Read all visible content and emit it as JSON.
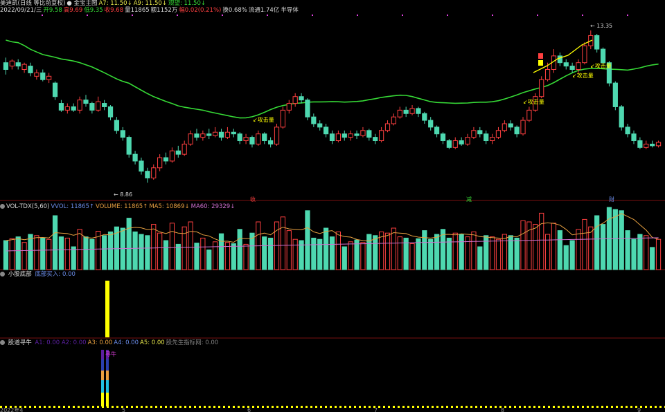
{
  "header": {
    "line1": [
      {
        "text": "美迪凯(日线 等比前复权)",
        "color": "#d8d8d8"
      },
      {
        "text": "● 金宝主图",
        "color": "#d8d8d8"
      },
      {
        "text": "A7: 11.50↓",
        "color": "#e8e84c"
      },
      {
        "text": "A9: 11.50↓",
        "color": "#e8e84c"
      },
      {
        "text": "观望: 11.50↓",
        "color": "#36d936"
      }
    ],
    "line2": [
      {
        "text": "2022/09/21/三",
        "color": "#d8d8d8"
      },
      {
        "text": "开9.58",
        "color": "#36d936"
      },
      {
        "text": "高9.69",
        "color": "#ff4040"
      },
      {
        "text": "低9.35",
        "color": "#36d936"
      },
      {
        "text": "收9.68",
        "color": "#ff4040"
      },
      {
        "text": "量11865",
        "color": "#d8d8d8"
      },
      {
        "text": "额1152万",
        "color": "#d8d8d8"
      },
      {
        "text": "幅0.02(0.21%)",
        "color": "#ff4040"
      },
      {
        "text": "换0.68%",
        "color": "#d8d8d8"
      },
      {
        "text": "流通1.74亿",
        "color": "#d8d8d8"
      },
      {
        "text": "半导体",
        "color": "#d8d8d8"
      }
    ]
  },
  "annotations": {
    "high_price": "13.35",
    "low_price": "8.86",
    "attack_volume_label": "攻击量",
    "marker_shou": "收",
    "marker_jian": "减",
    "marker_cai": "财"
  },
  "volume_panel": {
    "items": [
      {
        "text": "VOL-TDX(5,60)",
        "color": "#d8d8d8"
      },
      {
        "text": "VVOL: 11865↑",
        "color": "#6a8ce8"
      },
      {
        "text": "VOLUME: 11865↑",
        "color": "#e8a040"
      },
      {
        "text": "MA5: 10869↓",
        "color": "#e8a040"
      },
      {
        "text": "MA60: 29329↓",
        "color": "#d070d0"
      }
    ]
  },
  "bottom_panel": {
    "title": "小股底部",
    "buy_label": "底部买入: 0.00"
  },
  "finder_panel": {
    "title": "股道寻牛",
    "items": [
      {
        "text": "A1: 0.00  A2: 0.00",
        "color": "#5a20a0"
      },
      {
        "text": "A3: 0.00",
        "color": "#e8a040"
      },
      {
        "text": "A4: 0.00",
        "color": "#6a8ce8"
      },
      {
        "text": "A5: 0.00",
        "color": "#e8e84c"
      },
      {
        "text": "股先生指标网: 0.00",
        "color": "#808080"
      }
    ],
    "signal_label": "寻牛"
  },
  "x_axis": {
    "labels": [
      "2022年4",
      "5",
      "6",
      "7",
      "8",
      "9"
    ]
  },
  "colors": {
    "up": "#ff4040",
    "down": "#4ed8b0",
    "ma_line": "#36d936",
    "vol_ma5": "#e8a040",
    "vol_ma60": "#d070d0",
    "yellow": "#ffff00",
    "magenta": "#e040e0"
  },
  "chart_data": {
    "type": "candlestick",
    "dates_note": "daily bars, April–September 2022",
    "price_range": [
      8.5,
      13.8
    ],
    "high_marker": 13.35,
    "low_marker": 8.86,
    "candles": [
      [
        12.4,
        12.2,
        12.55,
        12.05
      ],
      [
        12.3,
        12.45,
        12.5,
        12.2
      ],
      [
        12.4,
        12.3,
        12.5,
        12.2
      ],
      [
        12.2,
        12.35,
        12.4,
        12.1
      ],
      [
        12.3,
        12.1,
        12.4,
        12.0
      ],
      [
        12.0,
        12.1,
        12.2,
        11.9
      ],
      [
        12.1,
        11.9,
        12.2,
        11.85
      ],
      [
        11.9,
        12.0,
        12.1,
        11.8
      ],
      [
        11.8,
        11.4,
        11.85,
        11.3
      ],
      [
        11.2,
        11.0,
        11.3,
        10.95
      ],
      [
        11.0,
        11.1,
        11.2,
        10.9
      ],
      [
        11.1,
        11.0,
        11.2,
        10.95
      ],
      [
        11.0,
        11.3,
        11.4,
        10.9
      ],
      [
        11.3,
        11.2,
        11.45,
        11.1
      ],
      [
        11.2,
        11.0,
        11.25,
        10.9
      ],
      [
        11.0,
        11.25,
        11.4,
        10.95
      ],
      [
        11.2,
        11.1,
        11.3,
        11.0
      ],
      [
        11.1,
        10.8,
        11.15,
        10.7
      ],
      [
        10.7,
        10.4,
        10.8,
        10.3
      ],
      [
        10.4,
        10.2,
        10.5,
        10.1
      ],
      [
        10.2,
        9.7,
        10.25,
        9.6
      ],
      [
        9.7,
        9.5,
        9.8,
        9.4
      ],
      [
        9.5,
        9.2,
        9.6,
        9.1
      ],
      [
        9.2,
        9.0,
        9.3,
        8.86
      ],
      [
        9.0,
        9.3,
        9.4,
        8.95
      ],
      [
        9.3,
        9.6,
        9.7,
        9.2
      ],
      [
        9.6,
        9.5,
        9.75,
        9.4
      ],
      [
        9.5,
        9.8,
        9.9,
        9.45
      ],
      [
        9.8,
        9.7,
        9.95,
        9.6
      ],
      [
        9.7,
        10.0,
        10.1,
        9.65
      ],
      [
        10.0,
        10.3,
        10.4,
        9.95
      ],
      [
        10.3,
        10.2,
        10.45,
        10.1
      ],
      [
        10.2,
        10.3,
        10.4,
        10.1
      ],
      [
        10.3,
        10.25,
        10.45,
        10.15
      ],
      [
        10.25,
        10.35,
        10.5,
        10.2
      ],
      [
        10.35,
        10.2,
        10.45,
        10.1
      ],
      [
        10.2,
        10.35,
        10.5,
        10.15
      ],
      [
        10.35,
        10.3,
        10.45,
        10.2
      ],
      [
        10.3,
        10.1,
        10.35,
        10.0
      ],
      [
        10.1,
        10.2,
        10.3,
        10.0
      ],
      [
        10.2,
        10.0,
        10.25,
        9.9
      ],
      [
        10.0,
        10.3,
        10.4,
        9.95
      ],
      [
        10.3,
        10.1,
        10.35,
        10.0
      ],
      [
        10.1,
        10.0,
        10.2,
        9.9
      ],
      [
        10.0,
        10.5,
        10.6,
        9.95
      ],
      [
        10.5,
        11.0,
        11.1,
        10.45
      ],
      [
        11.0,
        11.2,
        11.3,
        10.9
      ],
      [
        11.2,
        11.4,
        11.5,
        11.1
      ],
      [
        11.4,
        11.3,
        11.5,
        11.2
      ],
      [
        11.3,
        10.8,
        11.35,
        10.7
      ],
      [
        10.8,
        10.6,
        10.9,
        10.5
      ],
      [
        10.6,
        10.5,
        10.7,
        10.4
      ],
      [
        10.5,
        10.3,
        10.6,
        10.2
      ],
      [
        10.3,
        10.1,
        10.4,
        10.0
      ],
      [
        10.1,
        10.3,
        10.4,
        10.05
      ],
      [
        10.3,
        10.2,
        10.4,
        10.1
      ],
      [
        10.2,
        10.3,
        10.4,
        10.1
      ],
      [
        10.3,
        10.25,
        10.4,
        10.15
      ],
      [
        10.25,
        10.4,
        10.5,
        10.2
      ],
      [
        10.4,
        10.2,
        10.45,
        10.1
      ],
      [
        10.2,
        10.1,
        10.3,
        10.0
      ],
      [
        10.1,
        10.4,
        10.5,
        10.05
      ],
      [
        10.4,
        10.6,
        10.7,
        10.35
      ],
      [
        10.6,
        10.8,
        10.9,
        10.55
      ],
      [
        10.8,
        11.0,
        11.1,
        10.75
      ],
      [
        11.0,
        10.9,
        11.1,
        10.8
      ],
      [
        10.9,
        11.05,
        11.15,
        10.85
      ],
      [
        11.05,
        10.9,
        11.1,
        10.8
      ],
      [
        10.9,
        10.7,
        10.95,
        10.6
      ],
      [
        10.7,
        10.5,
        10.8,
        10.4
      ],
      [
        10.5,
        10.3,
        10.55,
        10.2
      ],
      [
        10.3,
        10.1,
        10.35,
        10.0
      ],
      [
        10.1,
        9.9,
        10.15,
        9.85
      ],
      [
        9.9,
        10.1,
        10.2,
        9.85
      ],
      [
        10.1,
        10.0,
        10.2,
        9.95
      ],
      [
        10.0,
        10.2,
        10.3,
        9.95
      ],
      [
        10.2,
        10.4,
        10.5,
        10.15
      ],
      [
        10.4,
        10.3,
        10.5,
        10.2
      ],
      [
        10.3,
        10.1,
        10.4,
        10.0
      ],
      [
        10.1,
        10.2,
        10.3,
        10.0
      ],
      [
        10.2,
        10.4,
        10.5,
        10.15
      ],
      [
        10.4,
        10.6,
        10.7,
        10.35
      ],
      [
        10.6,
        10.5,
        10.7,
        10.4
      ],
      [
        10.5,
        10.3,
        10.55,
        10.2
      ],
      [
        10.3,
        10.7,
        10.8,
        10.25
      ],
      [
        10.7,
        11.0,
        11.1,
        10.65
      ],
      [
        11.0,
        11.4,
        11.5,
        10.95
      ],
      [
        11.4,
        11.9,
        12.0,
        11.35
      ],
      [
        11.9,
        12.2,
        12.4,
        11.85
      ],
      [
        12.2,
        12.6,
        12.8,
        12.1
      ],
      [
        12.6,
        12.4,
        12.7,
        12.3
      ],
      [
        12.4,
        12.3,
        12.5,
        12.2
      ],
      [
        12.3,
        12.2,
        12.4,
        12.1
      ],
      [
        12.2,
        12.4,
        12.5,
        12.1
      ],
      [
        12.4,
        12.9,
        13.0,
        12.35
      ],
      [
        12.9,
        13.2,
        13.35,
        12.8
      ],
      [
        13.2,
        12.8,
        13.25,
        12.7
      ],
      [
        12.8,
        12.4,
        12.85,
        12.3
      ],
      [
        12.4,
        11.8,
        12.45,
        11.7
      ],
      [
        11.8,
        11.1,
        11.85,
        11.0
      ],
      [
        11.1,
        10.5,
        11.15,
        10.4
      ],
      [
        10.5,
        10.3,
        10.6,
        10.2
      ],
      [
        10.3,
        10.1,
        10.4,
        10.0
      ],
      [
        10.1,
        9.9,
        10.2,
        9.85
      ],
      [
        9.9,
        10.0,
        10.1,
        9.85
      ],
      [
        10.0,
        9.95,
        10.1,
        9.9
      ],
      [
        9.95,
        10.05,
        10.1,
        9.9
      ]
    ],
    "volume_max": 30000
  }
}
